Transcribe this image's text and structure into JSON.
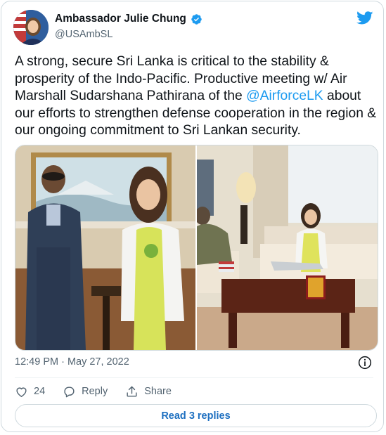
{
  "author": {
    "name": "Ambassador Julie Chung",
    "handle": "@USAmbSL"
  },
  "tweet": {
    "text_before": "A strong, secure Sri Lanka is critical to the stability & prosperity of the Indo-Pacific. Productive meeting w/ Air Marshall Sudarshana Pathirana of the ",
    "mention": "@AirforceLK",
    "text_after": " about our efforts to strengthen defense cooperation in the region & our ongoing commitment to Sri Lankan security."
  },
  "timestamp": "12:49 PM · May 27, 2022",
  "actions": {
    "like_count": "24",
    "reply_label": "Reply",
    "share_label": "Share"
  },
  "read_replies_label": "Read 3 replies",
  "icons": [
    "verified-badge-icon",
    "twitter-bird-icon",
    "info-icon",
    "heart-icon",
    "reply-icon",
    "share-icon"
  ],
  "colors": {
    "accent": "#1d9bf0",
    "secondary_text": "#536471",
    "border": "#cfd9de"
  }
}
